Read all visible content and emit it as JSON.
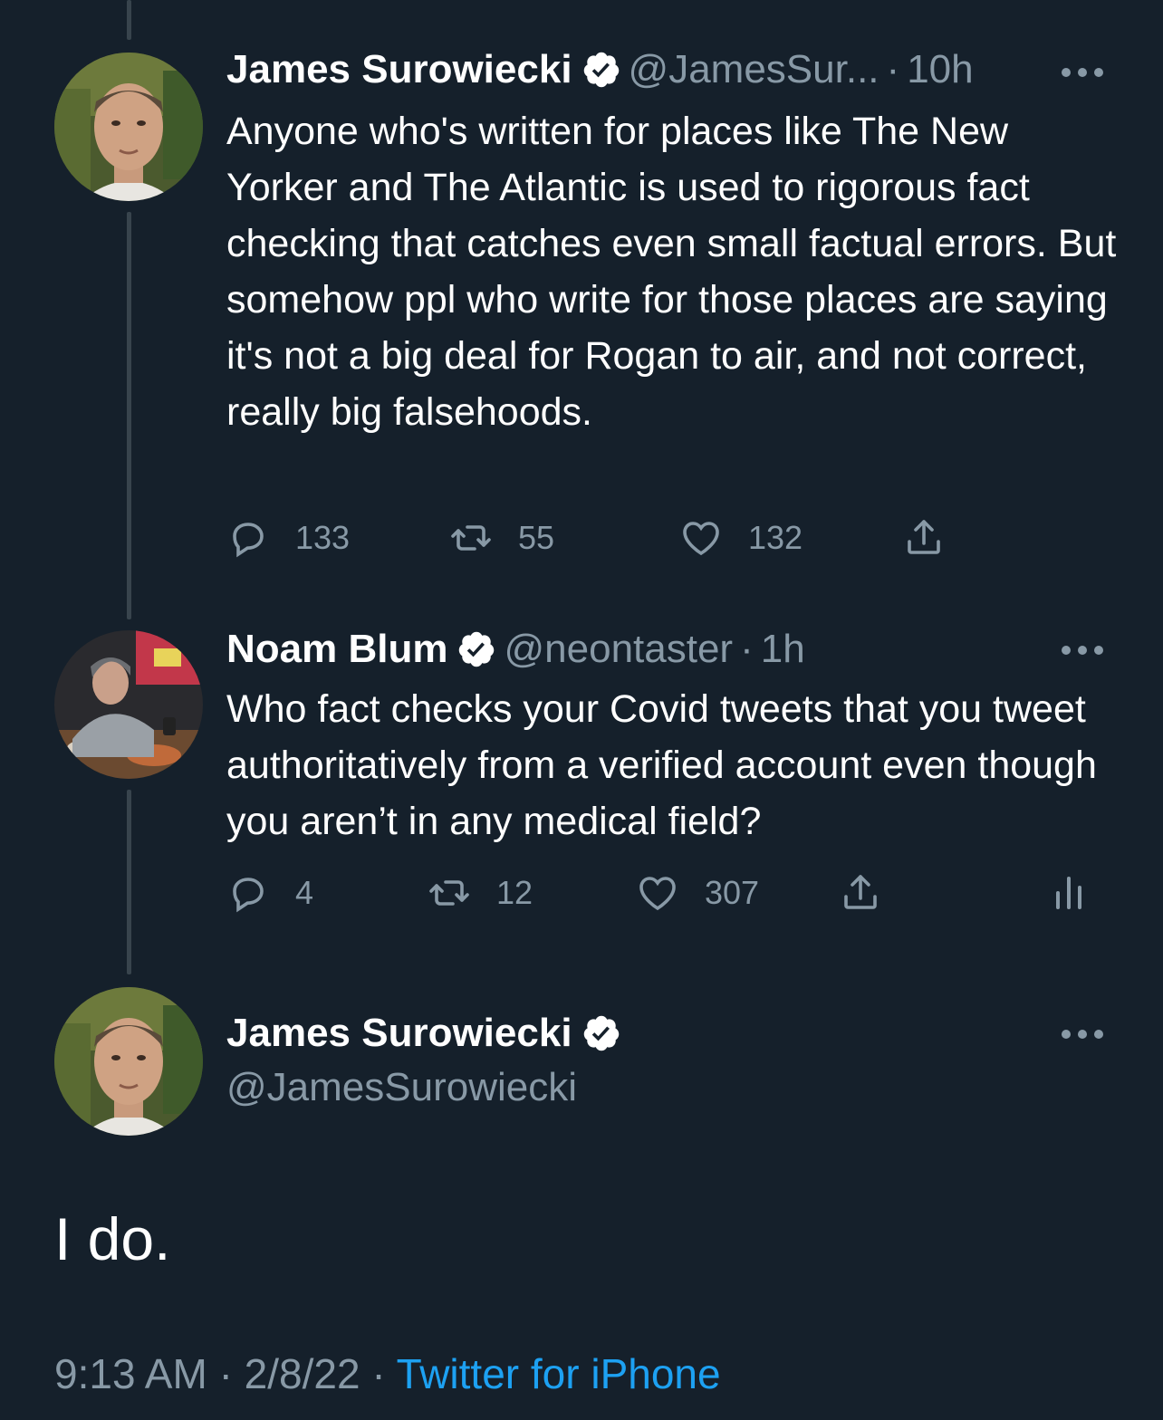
{
  "tweets": [
    {
      "name": "James Surowiecki",
      "handle": "@JamesSur...",
      "time": "10h",
      "text": "Anyone who's written for places like The New Yorker and The Atlantic is used to rigorous fact checking that catches even small factual errors. But somehow ppl who write for those places are saying it's not a big deal for Rogan to air, and not correct, really big falsehoods.",
      "replies": "133",
      "retweets": "55",
      "likes": "132"
    },
    {
      "name": "Noam Blum",
      "handle": "@neontaster",
      "time": "1h",
      "text": "Who fact checks your Covid tweets that you tweet authoritatively from a verified account even though you aren’t in any medical field?",
      "replies": "4",
      "retweets": "12",
      "likes": "307"
    }
  ],
  "main_tweet": {
    "name": "James Surowiecki",
    "handle": "@JamesSurowiecki",
    "text": "I do.",
    "time": "9:13 AM",
    "date": "2/8/22",
    "source": "Twitter for iPhone"
  },
  "separator": "·",
  "colors": {
    "background": "#15202b",
    "secondary_text": "#8899a6",
    "link": "#1da1f2",
    "thread_line": "#38444d"
  },
  "icons": [
    "verified-badge-icon",
    "more-icon",
    "reply-icon",
    "retweet-icon",
    "like-icon",
    "share-icon",
    "analytics-icon"
  ]
}
